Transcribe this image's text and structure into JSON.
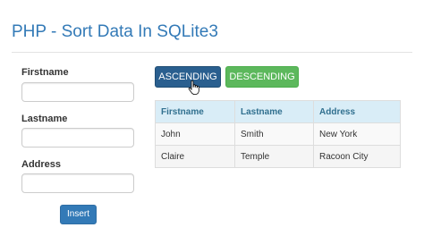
{
  "header": {
    "title": "PHP - Sort Data In SQLite3"
  },
  "form": {
    "firstname_label": "Firstname",
    "firstname_value": "",
    "lastname_label": "Lastname",
    "lastname_value": "",
    "address_label": "Address",
    "address_value": "",
    "insert_label": "Insert"
  },
  "sort": {
    "ascending_label": "ASCENDING",
    "descending_label": "DESCENDING"
  },
  "table": {
    "headers": [
      "Firstname",
      "Lastname",
      "Address"
    ],
    "rows": [
      [
        "John",
        "Smith",
        "New York"
      ],
      [
        "Claire",
        "Temple",
        "Racoon City"
      ]
    ]
  },
  "colors": {
    "title": "#337ab7",
    "primary": "#337ab7",
    "ascending_active": "#2a5f8f",
    "success": "#5cb85c",
    "table_header_bg": "#d9edf7"
  },
  "icons": {
    "cursor": "hand-pointer-icon"
  }
}
